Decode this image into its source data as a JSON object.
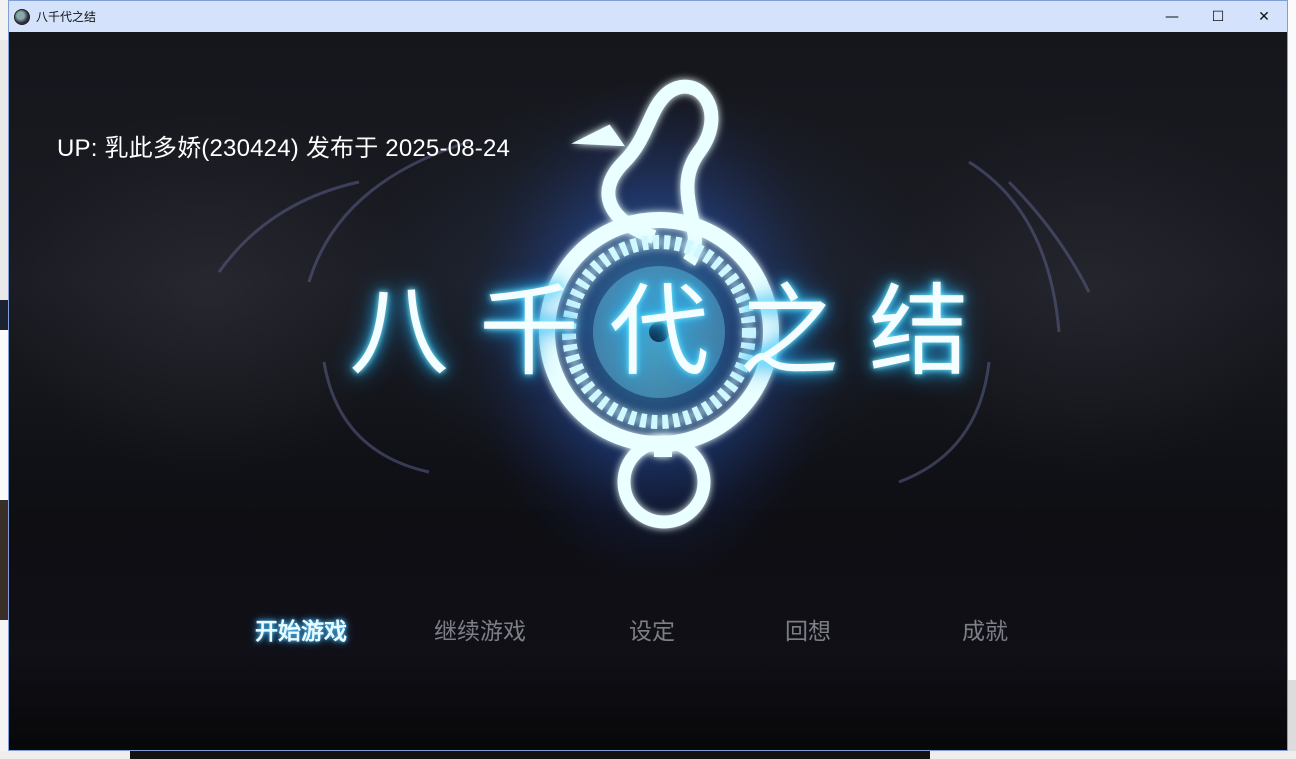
{
  "window": {
    "title": "八千代之结",
    "controls": {
      "minimize": "—",
      "maximize": "☐",
      "close": "✕"
    }
  },
  "overlay": {
    "uploader_info": "UP: 乳此多娇(230424) 发布于 2025-08-24"
  },
  "logo": {
    "characters": [
      "八",
      "千",
      "代",
      "之",
      "结"
    ],
    "glow_color": "#2ec8ff"
  },
  "menu": {
    "items": [
      {
        "label": "开始游戏",
        "active": true
      },
      {
        "label": "继续游戏",
        "active": false
      },
      {
        "label": "设定",
        "active": false
      },
      {
        "label": "回想",
        "active": false
      },
      {
        "label": "成就",
        "active": false
      }
    ]
  },
  "icons": {
    "app": "game-app-icon",
    "emblem": "snake-ring-emblem"
  }
}
